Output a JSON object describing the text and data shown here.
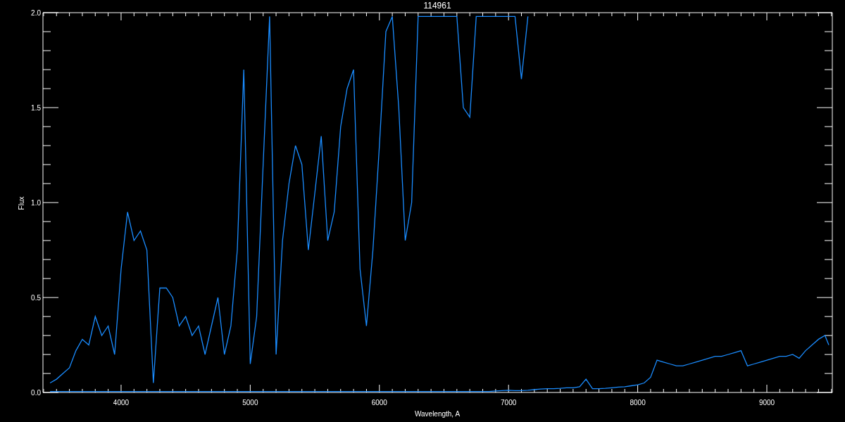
{
  "plot": {
    "chart_data": {
      "type": "line",
      "title": "114961",
      "xlabel": "Wavelength, A",
      "ylabel": "Flux",
      "x": [
        3450,
        3500,
        3550,
        3600,
        3650,
        3700,
        3750,
        3800,
        3850,
        3900,
        3950,
        4000,
        4050,
        4100,
        4150,
        4200,
        4250,
        4300,
        4350,
        4400,
        4450,
        4500,
        4550,
        4600,
        4650,
        4700,
        4750,
        4800,
        4850,
        4900,
        4950,
        5000,
        5050,
        5100,
        5150,
        5200,
        5250,
        5300,
        5350,
        5400,
        5450,
        5500,
        5550,
        5600,
        5650,
        5700,
        5750,
        5800,
        5850,
        5900,
        5950,
        6000,
        6050,
        6100,
        6150,
        6200,
        6250,
        6300,
        6350,
        6400,
        6450,
        6500,
        6550,
        6600,
        6650,
        6700,
        6750,
        6800,
        6850,
        6900,
        6950,
        7000,
        7050,
        7100,
        7150,
        7200,
        7250,
        7300,
        7350,
        7400,
        7450,
        7500,
        7550,
        7600,
        7650,
        7700,
        7750,
        7800,
        7850,
        7900,
        7950,
        8000,
        8050,
        8100,
        8150,
        8200,
        8250,
        8300,
        8350,
        8400,
        8450,
        8500,
        8550,
        8600,
        8650,
        8700,
        8750,
        8800,
        8850,
        8900,
        8950,
        9000,
        9050,
        9100,
        9150,
        9200,
        9250,
        9300,
        9350,
        9400,
        9450,
        9480
      ],
      "series": [
        {
          "color": "#1a8cff",
          "values": [
            0.05,
            0.07,
            0.1,
            0.13,
            0.22,
            0.28,
            0.25,
            0.4,
            0.3,
            0.35,
            0.2,
            0.65,
            0.95,
            0.8,
            0.85,
            0.75,
            0.05,
            0.55,
            0.55,
            0.5,
            0.35,
            0.4,
            0.3,
            0.35,
            0.2,
            0.35,
            0.5,
            0.2,
            0.35,
            0.75,
            1.7,
            0.15,
            0.4,
            1.2,
            1.98,
            0.2,
            0.8,
            1.1,
            1.3,
            1.2,
            0.75,
            1.05,
            1.35,
            0.8,
            0.95,
            1.4,
            1.6,
            1.7,
            0.65,
            0.35,
            0.75,
            1.3,
            1.9,
            1.98,
            1.5,
            0.8,
            1.0,
            1.98,
            1.98,
            1.98,
            1.98,
            1.98,
            1.98,
            1.98,
            1.5,
            1.45,
            1.98,
            1.98,
            1.98,
            1.98,
            1.98,
            1.98,
            1.98,
            1.65,
            1.98,
            null,
            null,
            null,
            null,
            null,
            null,
            null,
            null,
            null,
            null,
            null,
            null,
            null,
            null,
            null,
            null,
            null,
            null,
            null,
            null,
            null,
            null,
            null,
            null,
            null,
            null,
            null,
            null,
            null,
            null,
            null,
            null,
            null,
            null,
            null,
            null,
            null,
            null,
            null,
            null,
            null,
            null,
            null,
            null,
            null,
            null,
            null
          ]
        },
        {
          "color": "#1a8cff",
          "values": [
            0.005,
            0.005,
            0.005,
            0.005,
            0.005,
            0.005,
            0.005,
            0.005,
            0.005,
            0.005,
            0.005,
            0.005,
            0.005,
            0.005,
            0.005,
            0.005,
            0.005,
            0.005,
            0.005,
            0.005,
            0.005,
            0.005,
            0.005,
            0.005,
            0.005,
            0.005,
            0.005,
            0.005,
            0.005,
            0.005,
            0.005,
            0.005,
            0.005,
            0.005,
            0.005,
            0.005,
            0.005,
            0.005,
            0.005,
            0.005,
            0.005,
            0.005,
            0.005,
            0.005,
            0.005,
            0.005,
            0.005,
            0.005,
            0.005,
            0.005,
            0.005,
            0.005,
            0.005,
            0.005,
            0.005,
            0.005,
            0.005,
            0.005,
            0.005,
            0.005,
            0.005,
            0.005,
            0.005,
            0.005,
            0.005,
            0.005,
            0.005,
            0.005,
            0.005,
            0.008,
            0.01,
            0.012,
            0.01,
            0.01,
            0.012,
            0.015,
            0.018,
            0.02,
            0.02,
            0.022,
            0.025,
            0.025,
            0.03,
            0.07,
            0.02,
            0.02,
            0.022,
            0.025,
            0.028,
            0.03,
            0.035,
            0.04,
            0.05,
            0.08,
            0.17,
            0.16,
            0.15,
            0.14,
            0.14,
            0.15,
            0.16,
            0.17,
            0.18,
            0.19,
            0.19,
            0.2,
            0.21,
            0.22,
            0.14,
            0.15,
            0.16,
            0.17,
            0.18,
            0.19,
            0.19,
            0.2,
            0.18,
            0.22,
            0.25,
            0.28,
            0.3,
            0.25
          ]
        }
      ],
      "xlim": [
        3395,
        9507
      ],
      "ylim": [
        0,
        2
      ],
      "xticks": [
        4000,
        5000,
        6000,
        7000,
        8000,
        9000
      ],
      "yticks": [
        {
          "value": 0,
          "label": "0.0"
        },
        {
          "value": 0.5,
          "label": "0.5"
        },
        {
          "value": 1,
          "label": "1.0"
        },
        {
          "value": 1.5,
          "label": "1.5"
        },
        {
          "value": 2,
          "label": "2.0"
        }
      ]
    }
  }
}
